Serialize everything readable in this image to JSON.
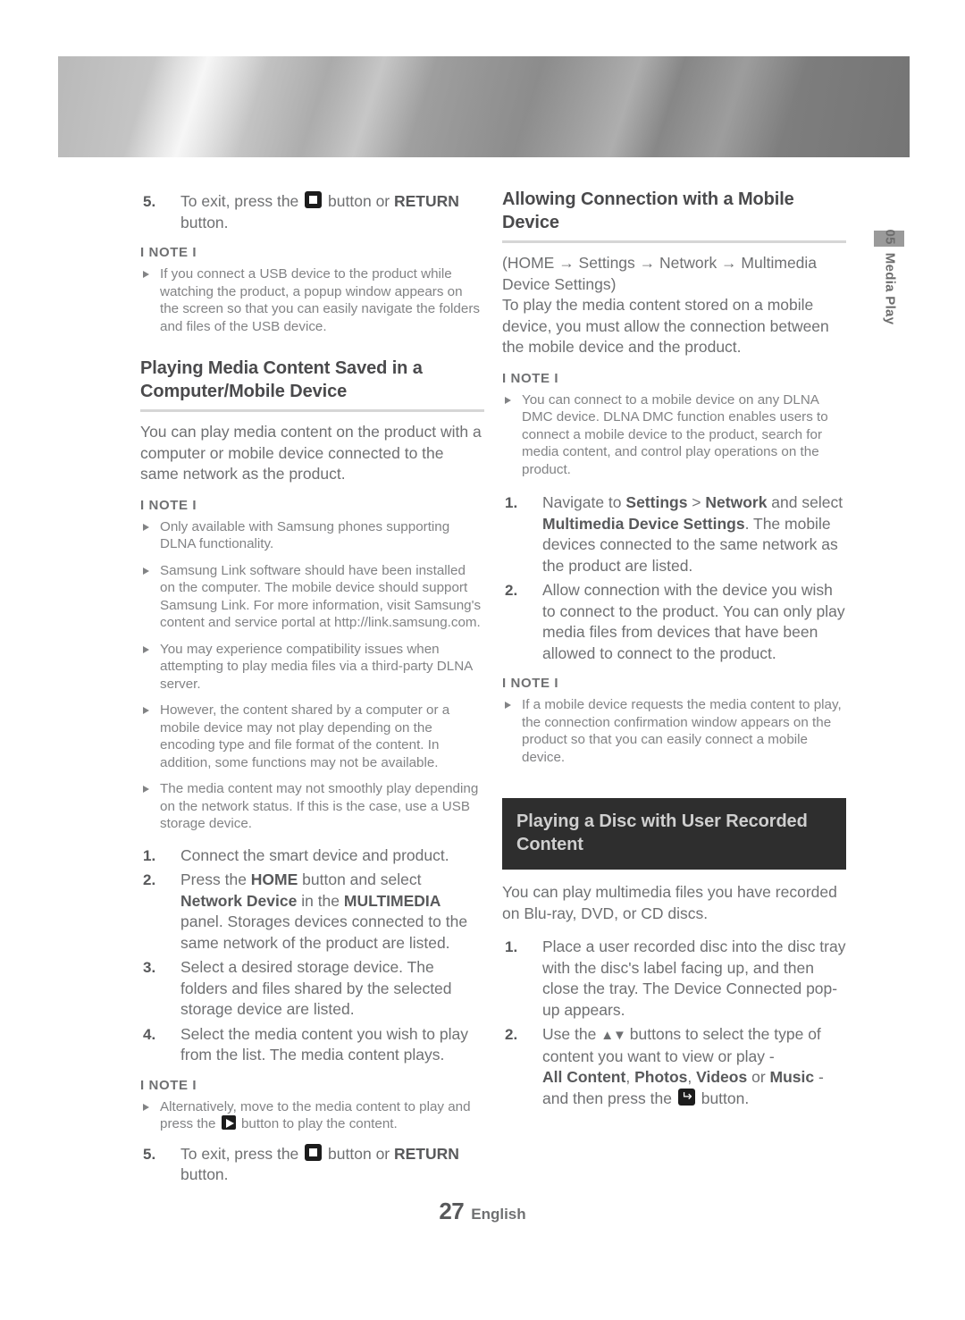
{
  "chapter_tab": {
    "number": "05",
    "label": "Media Play"
  },
  "footer": {
    "page_number": "27",
    "language": "English"
  },
  "note_label": "I NOTE I",
  "left_column": {
    "step5_top": {
      "number": "5.",
      "text_before": "To exit, press the",
      "key_icon": "stop-button-icon",
      "text_after": "button or",
      "bold_word": "RETURN",
      "text_end": "button."
    },
    "note_top": [
      "If you connect a USB device to the product while watching the product, a popup window appears on the screen so that you can easily navigate the folders and files of the USB device."
    ],
    "heading": "Playing Media Content Saved in a Computer/Mobile Device",
    "intro": "You can play media content on the product with a computer or mobile device connected to the same network as the product.",
    "notes": [
      "Only available with Samsung phones supporting DLNA functionality.",
      "Samsung Link software should have been installed on the computer. The mobile device should support Samsung Link. For more information, visit Samsung's content and service portal at http://link.samsung.com.",
      "You may experience compatibility issues when attempting to play media files via a third-party DLNA server.",
      "However, the content shared by a computer or a mobile device may not play depending on the encoding type and file format of the content. In addition, some functions may not be available.",
      "The media content may not smoothly play depending on the network status. If this is the case, use a USB storage device."
    ],
    "steps": [
      {
        "number": "1.",
        "text": "Connect the smart device and product."
      },
      {
        "number": "2.",
        "text": "Press the HOME button and select Network Device in the MULTIMEDIA panel. Storages devices connected to the same network of the product are listed."
      },
      {
        "number": "3.",
        "text": "Select a desired storage device. The folders and files shared by the selected storage device are listed."
      },
      {
        "number": "4.",
        "text": "Select the media content you wish to play from the list. The media content plays."
      }
    ],
    "note_bottom": {
      "text_before": "Alternatively, move to the media content to play and press the",
      "key_icon": "play-button-icon",
      "text_after": "button to play the content."
    },
    "step5_bottom": {
      "number": "5.",
      "text_before": "To exit, press the",
      "key_icon": "stop-button-icon",
      "text_after": "button or",
      "bold_word": "RETURN",
      "text_end": "button."
    }
  },
  "right_column": {
    "heading": "Allowing Connection with a Mobile Device",
    "path": "(HOME → Settings → Network → Multimedia Device Settings)",
    "intro": "To play the media content stored on a mobile device, you must allow the connection between the mobile device and the product.",
    "notes_top": [
      "You can connect to a mobile device on any DLNA DMC device. DLNA DMC function enables users to connect a mobile device to the product, search for media content, and control play operations on the product."
    ],
    "steps": [
      {
        "number": "1.",
        "text": "Navigate to Settings > Network and select Multimedia Device Settings. The mobile devices connected to the same network as the product are listed."
      },
      {
        "number": "2.",
        "text": "Allow connection with the device you wish to connect to the product. You can only play media files from devices that have been allowed to connect to the product."
      }
    ],
    "notes_bottom": [
      "If a mobile device requests the media content to play, the connection confirmation window appears on the product so that you can easily connect a mobile device."
    ],
    "banner_heading": "Playing a Disc with User Recorded Content",
    "disc_intro": "You can play multimedia files you have recorded on Blu-ray, DVD, or CD discs.",
    "disc_steps": [
      {
        "number": "1.",
        "text": "Place a user recorded disc into the disc tray with the disc's label facing up, and then close the tray. The Device Connected pop-up appears."
      },
      {
        "number": "2.",
        "text_a": "Use the",
        "arrows": "▲▼",
        "text_b": "buttons to select the type of content you want to view or play -",
        "bold_1": "All Content",
        "sep_1": ",",
        "bold_2": "Photos",
        "sep_2": ",",
        "bold_3": "Videos",
        "sep_3": "or",
        "bold_4": "Music",
        "text_c": "- and then press the",
        "key_icon": "enter-button-icon",
        "text_d": "button."
      }
    ]
  }
}
